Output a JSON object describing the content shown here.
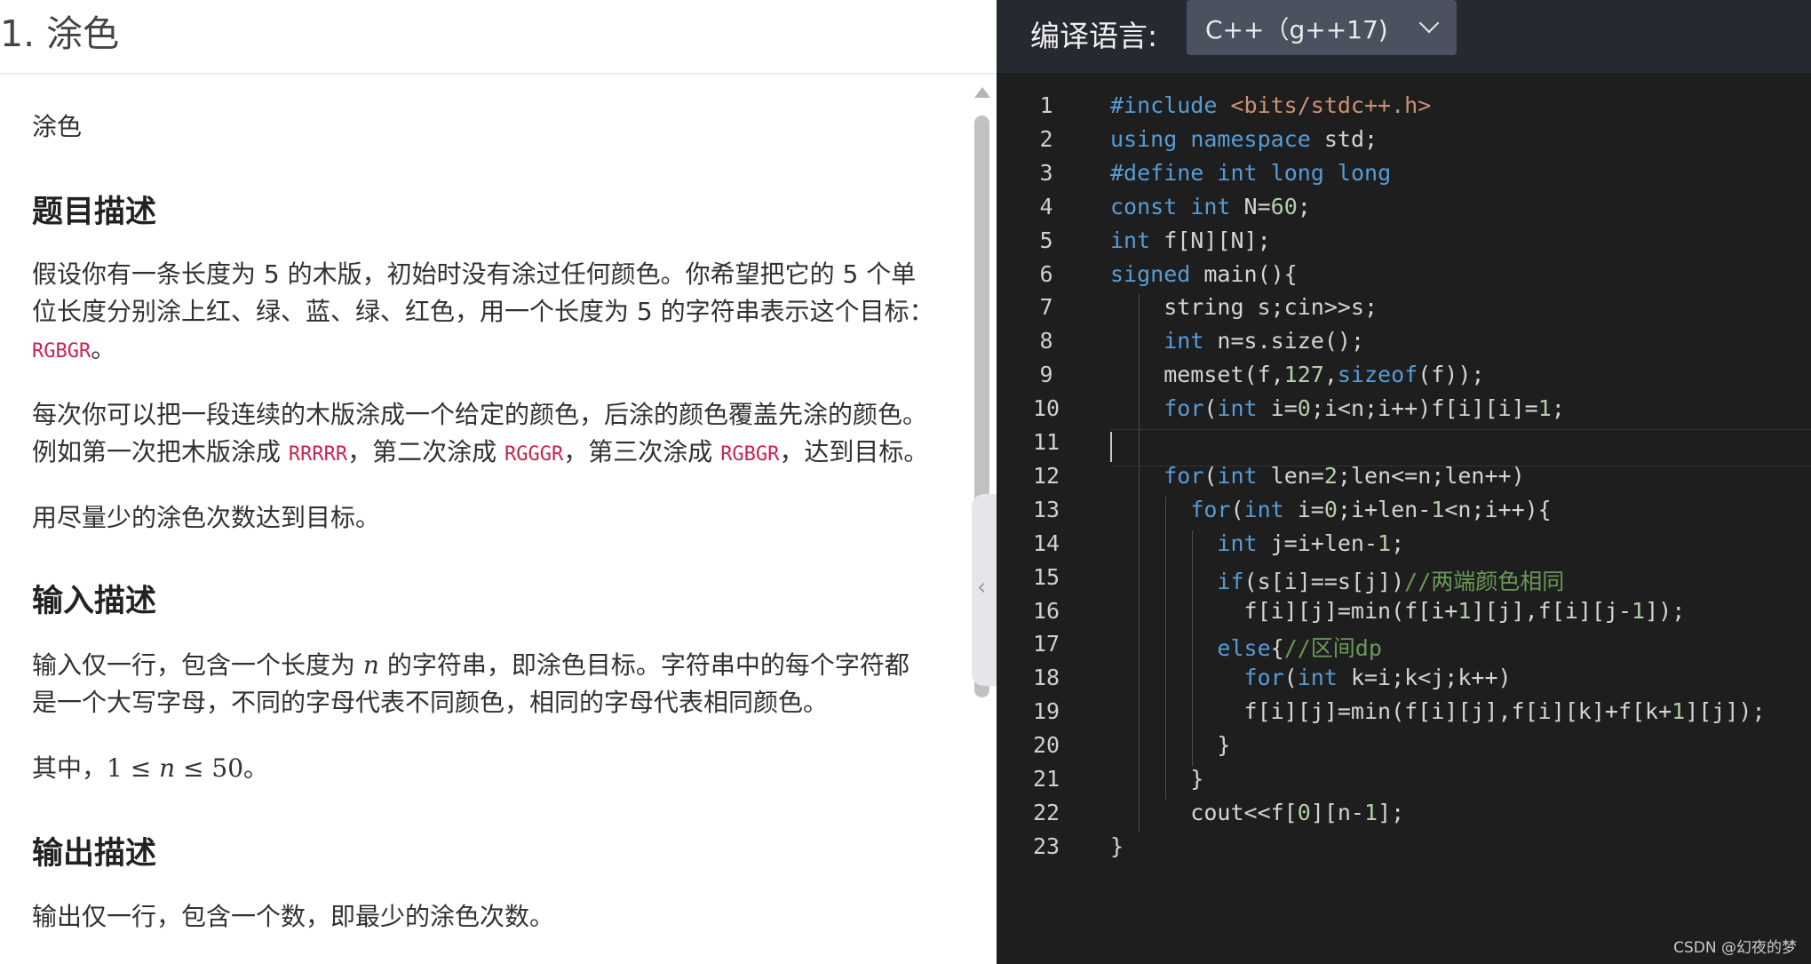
{
  "problem": {
    "title": "1. 涂色",
    "subtitle": "涂色",
    "sections": {
      "description_heading": "题目描述",
      "input_heading": "输入描述",
      "output_heading": "输出描述"
    },
    "desc_p1_line1": "假设你有一条长度为 5 的木版，初始时没有涂过任何颜色。你希望把它的 5 个单",
    "desc_p1_line2": "位长度分别涂上红、绿、蓝、绿、红色，用一个长度为 5 的字符串表示这个目标：",
    "desc_p1_code": "RGBGR",
    "desc_p1_end": "。",
    "desc_p2_line1": "每次你可以把一段连续的木版涂成一个给定的颜色，后涂的颜色覆盖先涂的颜色。",
    "desc_p2_line2_a": "例如第一次把木版涂成 ",
    "desc_p2_code1": "RRRRR",
    "desc_p2_line2_b": "，第二次涂成 ",
    "desc_p2_code2": "RGGGR",
    "desc_p2_line2_c": "，第三次涂成 ",
    "desc_p2_code3": "RGBGR",
    "desc_p2_line2_d": "，达到目标。",
    "desc_p3": "用尽量少的涂色次数达到目标。",
    "input_line1_a": "输入仅一行，包含一个长度为 ",
    "input_var": "n",
    "input_line1_b": " 的字符串，即涂色目标。字符串中的每个字符都",
    "input_line2": "是一个大写字母，不同的字母代表不同颜色，相同的字母代表相同颜色。",
    "constraint_prefix": "其中，",
    "constraint_math_a": "1 ≤ ",
    "constraint_var": "n",
    "constraint_math_b": " ≤ 50",
    "constraint_suffix": "。",
    "output_line": "输出仅一行，包含一个数，即最少的涂色次数。"
  },
  "editor": {
    "language_label": "编译语言:",
    "language_value": "C++（g++17)",
    "watermark": "CSDN @幻夜的梦",
    "line_numbers": [
      "1",
      "2",
      "3",
      "4",
      "5",
      "6",
      "7",
      "8",
      "9",
      "10",
      "11",
      "12",
      "13",
      "14",
      "15",
      "16",
      "17",
      "18",
      "19",
      "20",
      "21",
      "22",
      "23"
    ],
    "code_lines": [
      "#include <bits/stdc++.h>",
      "using namespace std;",
      "#define int long long",
      "const int N=60;",
      "int f[N][N];",
      "signed main(){",
      "    string s;cin>>s;",
      "    int n=s.size();",
      "    memset(f,127,sizeof(f));",
      "    for(int i=0;i<n;i++)f[i][i]=1;",
      "",
      "    for(int len=2;len<=n;len++)",
      "      for(int i=0;i+len-1<n;i++){",
      "        int j=i+len-1;",
      "        if(s[i]==s[j])//两端颜色相同",
      "          f[i][j]=min(f[i+1][j],f[i][j-1]);",
      "        else{//区间dp",
      "          for(int k=i;k<j;k++)",
      "          f[i][j]=min(f[i][j],f[i][k]+f[k+1][j]);",
      "        }",
      "      }",
      "      cout<<f[0][n-1];",
      "}"
    ]
  },
  "colors": {
    "editor_bg": "#1e1e1e",
    "header_bg": "#252a31",
    "keyword": "#569cd6",
    "number": "#b5cea8",
    "comment": "#6a9955",
    "include": "#ce9178",
    "inline_code": "#c7254e"
  }
}
